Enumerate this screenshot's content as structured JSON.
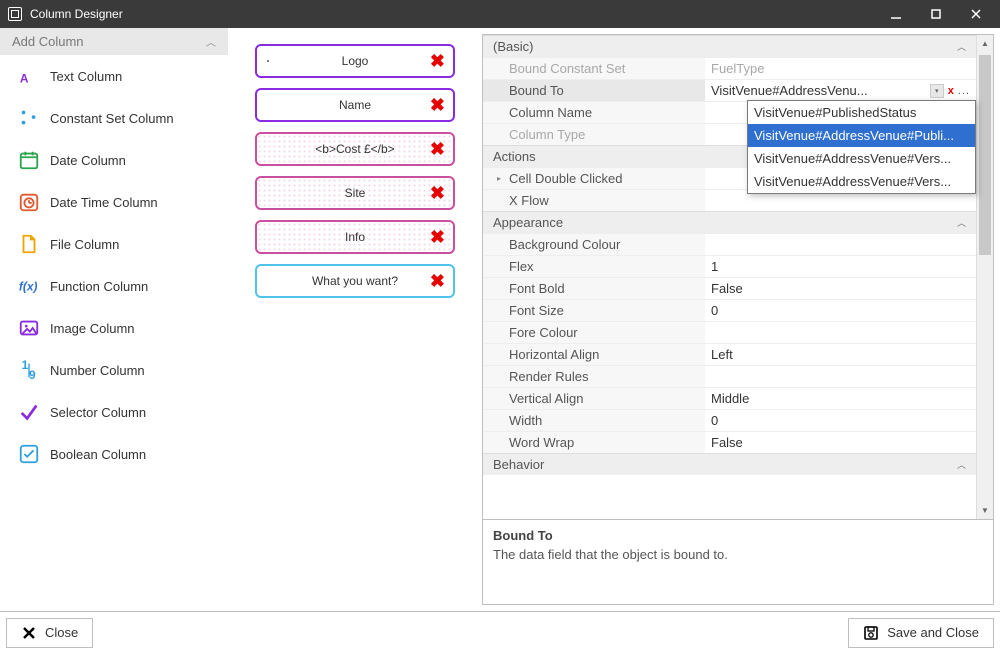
{
  "window": {
    "title": "Column Designer"
  },
  "sidebar": {
    "header": "Add Column",
    "items": [
      {
        "key": "text",
        "label": "Text Column",
        "color": "#8a2be2"
      },
      {
        "key": "constset",
        "label": "Constant Set Column",
        "color": "#2f9fe0"
      },
      {
        "key": "date",
        "label": "Date Column",
        "color": "#2da44e"
      },
      {
        "key": "datetime",
        "label": "Date Time Column",
        "color": "#e05a2f"
      },
      {
        "key": "file",
        "label": "File Column",
        "color": "#f0a500"
      },
      {
        "key": "function",
        "label": "Function Column",
        "color": "#2f6fd0"
      },
      {
        "key": "image",
        "label": "Image Column",
        "color": "#8a2be2"
      },
      {
        "key": "number",
        "label": "Number Column",
        "color": "#2f9fe0"
      },
      {
        "key": "selector",
        "label": "Selector Column",
        "color": "#8a2be2"
      },
      {
        "key": "boolean",
        "label": "Boolean Column",
        "color": "#2f9fe0"
      }
    ]
  },
  "chips": [
    {
      "label": "Logo",
      "style": "purple",
      "dot": true
    },
    {
      "label": "Name",
      "style": "purple",
      "dot": false
    },
    {
      "label": "<b>Cost £</b>",
      "style": "pink",
      "dot": false
    },
    {
      "label": "Site",
      "style": "pink",
      "dot": false
    },
    {
      "label": "Info",
      "style": "pink",
      "dot": false
    },
    {
      "label": "What you want?",
      "style": "cyan",
      "dot": false
    }
  ],
  "propgrid": {
    "categories": [
      {
        "name": "(Basic)",
        "rows": [
          {
            "label": "Bound Constant Set",
            "value": "FuelType",
            "disabled": true
          },
          {
            "label": "Bound To",
            "value": "VisitVenue#AddressVenu...",
            "selected": true,
            "combo": true
          },
          {
            "label": "Column Name",
            "value": ""
          },
          {
            "label": "Column Type",
            "value": "",
            "disabled": true
          }
        ]
      },
      {
        "name": "Actions",
        "rows": [
          {
            "label": "Cell Double Clicked",
            "value": "",
            "sub": true
          },
          {
            "label": "X Flow",
            "value": ""
          }
        ]
      },
      {
        "name": "Appearance",
        "rows": [
          {
            "label": "Background Colour",
            "value": ""
          },
          {
            "label": "Flex",
            "value": "1"
          },
          {
            "label": "Font Bold",
            "value": "False"
          },
          {
            "label": "Font Size",
            "value": "0"
          },
          {
            "label": "Fore Colour",
            "value": ""
          },
          {
            "label": "Horizontal Align",
            "value": "Left"
          },
          {
            "label": "Render Rules",
            "value": ""
          },
          {
            "label": "Vertical Align",
            "value": "Middle"
          },
          {
            "label": "Width",
            "value": "0"
          },
          {
            "label": "Word Wrap",
            "value": "False"
          }
        ]
      },
      {
        "name": "Behavior",
        "rows": []
      }
    ],
    "dropdown": {
      "top_offset_rows": 2,
      "options": [
        {
          "text": "VisitVenue#PublishedStatus",
          "selected": false
        },
        {
          "text": "VisitVenue#AddressVenue#Publi...",
          "selected": true
        },
        {
          "text": "VisitVenue#AddressVenue#Vers...",
          "selected": false
        },
        {
          "text": "VisitVenue#AddressVenue#Vers...",
          "selected": false
        }
      ]
    }
  },
  "help": {
    "heading": "Bound To",
    "body": "The data field that the object is bound to."
  },
  "footer": {
    "close": "Close",
    "save": "Save and Close"
  }
}
